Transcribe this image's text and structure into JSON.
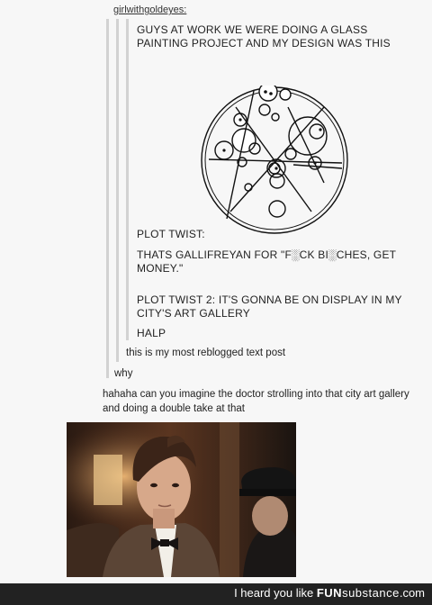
{
  "post": {
    "username": "girlwithgoldeyes:",
    "lines": [
      "GUYS AT WORK WE WERE DOING A GLASS",
      "PAINTING PROJECT AND MY DESIGN WAS THIS",
      "PLOT TWIST:",
      "THATS GALLIFREYAN FOR \"F░CK BI░CHES, GET",
      "MONEY.\"",
      "PLOT TWIST 2: IT'S GONNA BE ON DISPLAY IN MY",
      "CITY'S ART GALLERY",
      "HALP"
    ],
    "reblog_1": "this is my most reblogged text post",
    "reblog_2": "why",
    "reply_1": "hahaha can you imagine the doctor strolling into that city art gallery",
    "reply_2": "and doing a double take at that"
  },
  "footer": {
    "prefix": "I heard you like ",
    "brand_bold": "FUN",
    "brand_rest": "substance",
    "domain": ".com"
  },
  "colors": {
    "footer_bg": "#222222",
    "quote_bar": "#d2d2d2",
    "page_bg": "#f7f7f7"
  }
}
